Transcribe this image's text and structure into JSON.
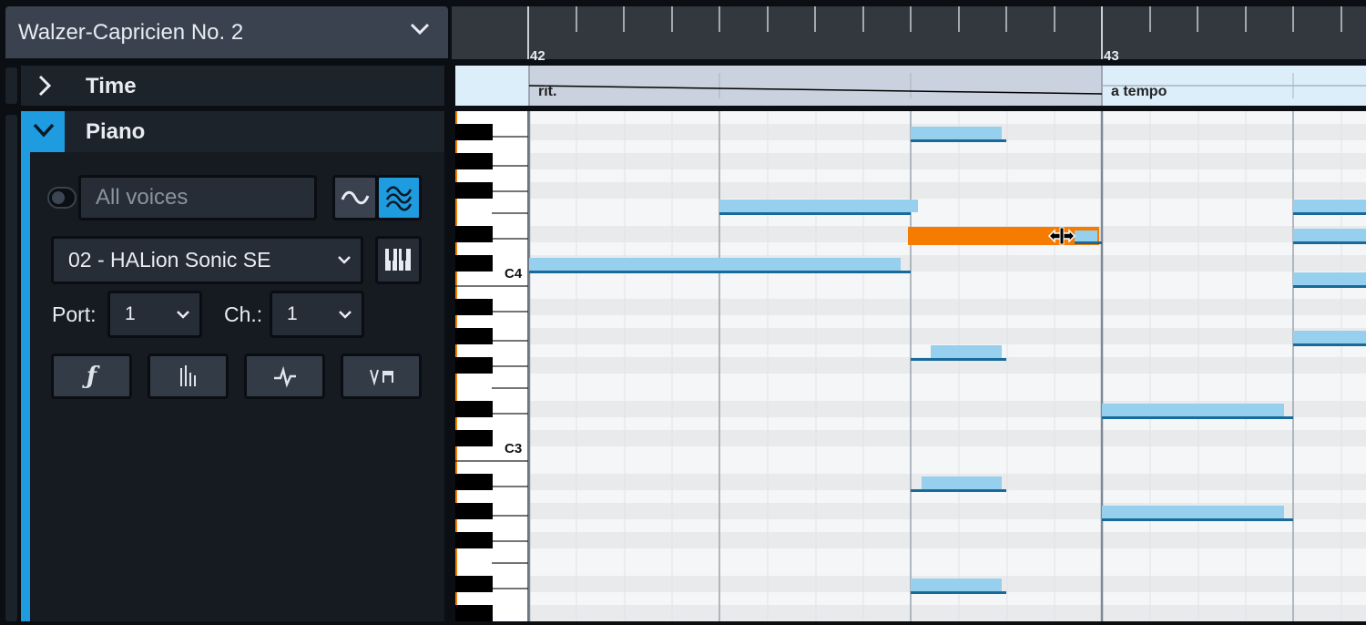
{
  "flow": {
    "title": "Walzer-Capricien No. 2"
  },
  "tracks": {
    "time": {
      "label": "Time"
    },
    "piano": {
      "label": "Piano"
    }
  },
  "inspector": {
    "voices_placeholder": "All voices",
    "endpoint": "02 - HALion Sonic SE",
    "port_label": "Port:",
    "port_value": "1",
    "channel_label": "Ch.:",
    "channel_value": "1",
    "edit_buttons": [
      "dynamics-icon",
      "velocity-icon",
      "controller-icon",
      "articulation-icon"
    ]
  },
  "ruler": {
    "bars": [
      "42",
      "43"
    ]
  },
  "tempo": {
    "rit_label": "rit.",
    "a_tempo_label": "a tempo"
  },
  "keyboard": {
    "labels": [
      "C4",
      "C3"
    ]
  },
  "colors": {
    "accent": "#1f9be0",
    "note_fill": "#97cfee",
    "note_line": "#176a9a",
    "selected_note": "#f57c00"
  }
}
